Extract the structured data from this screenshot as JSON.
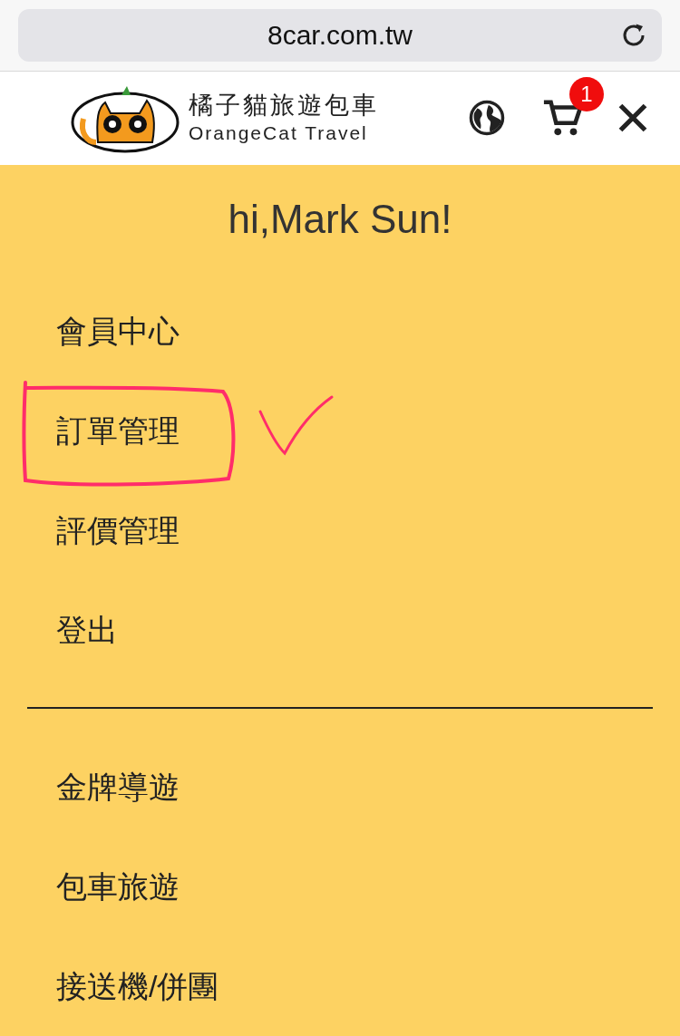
{
  "address_bar": {
    "url": "8car.com.tw"
  },
  "header": {
    "logo": {
      "title": "橘子貓旅遊包車",
      "subtitle": "OrangeCat Travel"
    },
    "cart_count": "1"
  },
  "greeting": "hi,Mark Sun!",
  "account_menu": [
    {
      "label": "會員中心",
      "annotated": false
    },
    {
      "label": "訂單管理",
      "annotated": true
    },
    {
      "label": "評價管理",
      "annotated": false
    },
    {
      "label": "登出",
      "annotated": false
    }
  ],
  "main_menu": [
    {
      "label": "金牌導遊"
    },
    {
      "label": "包車旅遊"
    },
    {
      "label": "接送機/併團"
    }
  ]
}
